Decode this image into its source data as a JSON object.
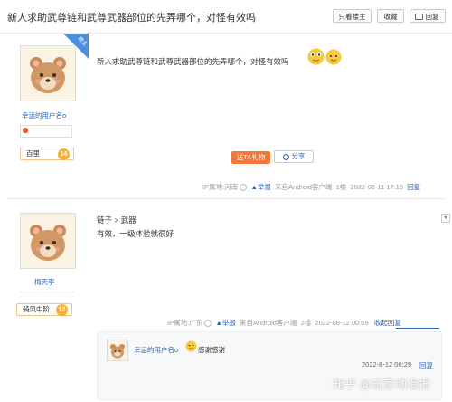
{
  "header": {
    "title": "新人求助武尊链和武尊武器部位的先弄哪个，对怪有效吗",
    "buttons": {
      "only_op": "只看楼主",
      "favorite": "收藏",
      "reply": "回复"
    }
  },
  "posts": [
    {
      "badge": "楼主",
      "username": "幸运的用户名o",
      "level_name": "百里",
      "level_num": "14",
      "content": "新人求助武尊链和武尊武器部位的先弄哪个，对怪有效吗",
      "gift_label": "送TA礼物",
      "share_label": "分享",
      "meta": {
        "ip": "IP属地:河南",
        "report": "举报",
        "client": "来自Android客户端",
        "floor": "1楼",
        "time": "2022-08-11 17:16",
        "reply": "回复"
      }
    },
    {
      "username": "梅天李",
      "level_name": "骑风中阶",
      "level_num": "12",
      "content_line1": "链子 > 武器",
      "content_line2": "有效，一级体验就很好",
      "meta": {
        "ip": "IP属地:广东",
        "report": "举报",
        "client": "来自Android客户端",
        "floor": "2楼",
        "time": "2022-08-12 00:09",
        "reply": "收起回复"
      },
      "sub_reply": {
        "username": "幸运的用户名o",
        "text": "感谢感谢",
        "time": "2022-8-12 06:29",
        "reply": "回复"
      }
    }
  ],
  "watermark": "知乎 @玩家动漫报",
  "colors": {
    "link": "#2d64b3",
    "accent": "#f4773a",
    "badge": "#4a8fe0"
  }
}
